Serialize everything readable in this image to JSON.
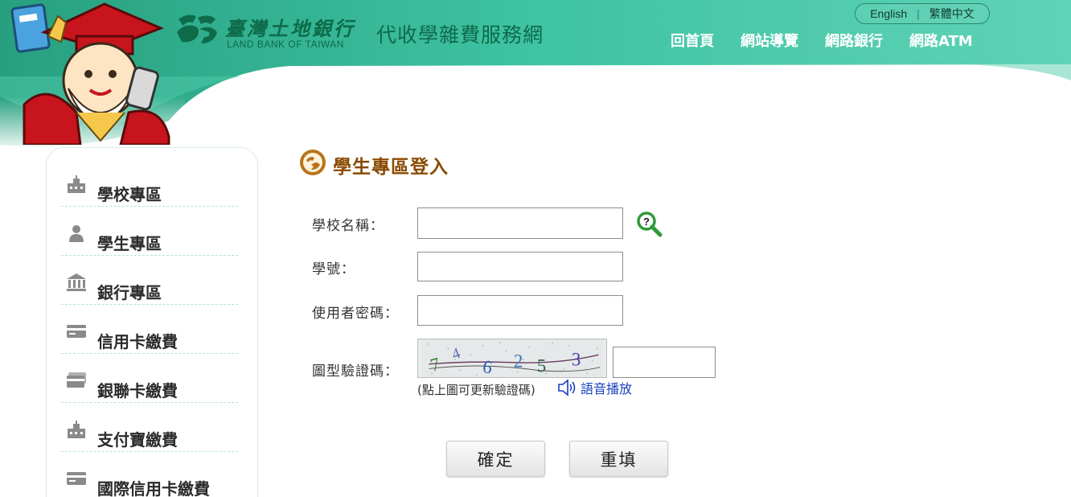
{
  "header": {
    "bank_name_zh": "臺灣土地銀行",
    "bank_name_en": "LAND BANK OF TAIWAN",
    "site_title": "代收學雜費服務網",
    "lang_english": "English",
    "lang_chinese": "繁體中文",
    "nav": [
      "回首頁",
      "網站導覽",
      "網路銀行",
      "網路ATM"
    ]
  },
  "sidebar": {
    "items": [
      {
        "label": "學校專區",
        "icon": "school-icon"
      },
      {
        "label": "學生專區",
        "icon": "student-icon"
      },
      {
        "label": "銀行專區",
        "icon": "bank-icon"
      },
      {
        "label": "信用卡繳費",
        "icon": "credit-card-icon"
      },
      {
        "label": "銀聯卡繳費",
        "icon": "unionpay-card-icon"
      },
      {
        "label": "支付寶繳費",
        "icon": "alipay-icon"
      },
      {
        "label": "國際信用卡繳費",
        "icon": "intl-credit-card-icon"
      }
    ]
  },
  "main": {
    "title": "學生專區登入",
    "form": {
      "school_label": "學校名稱：",
      "school_value": "",
      "student_id_label": "學號：",
      "student_id_value": "",
      "password_label": "使用者密碼：",
      "password_value": "",
      "captcha_label": "圖型驗證碼：",
      "captcha_value": "",
      "captcha_hint": "(點上圖可更新驗證碼)",
      "audio_label": "語音播放"
    },
    "buttons": {
      "confirm": "確定",
      "reset": "重填"
    }
  },
  "colors": {
    "header_teal": "#3cbf9f",
    "brand_green": "#0d6b4a",
    "title_brown": "#8a4a00",
    "link_blue": "#1a3fbf"
  }
}
